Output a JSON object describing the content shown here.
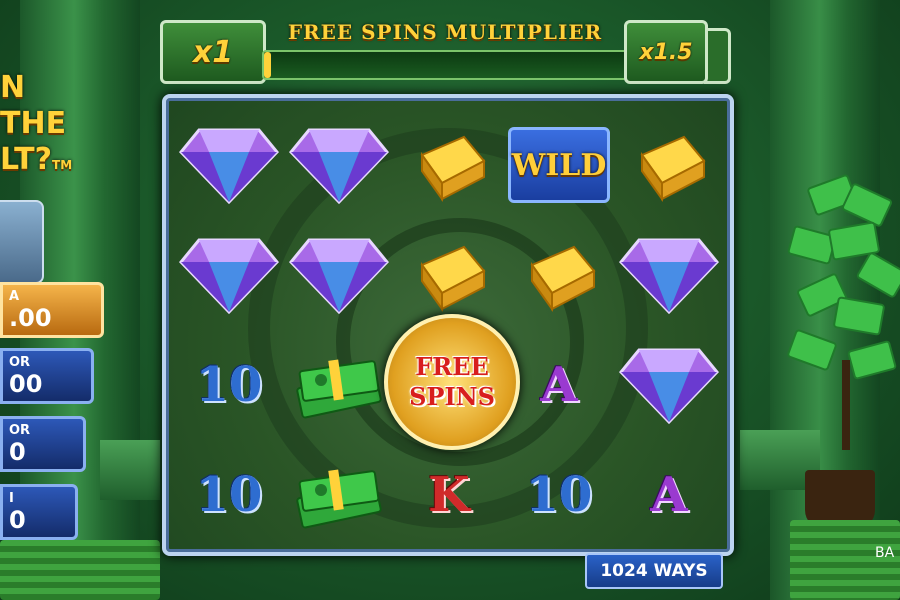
{
  "top_bar": {
    "title": "FREE SPINS MULTIPLIER",
    "multiplier_current": "x1",
    "multiplier_next": "x1.5",
    "progress": 0.02
  },
  "side_panel": {
    "title_line1": "N THE",
    "title_line2": "LT?",
    "trademark": "TM",
    "jackpots": [
      {
        "name": "A",
        "value": ".00",
        "icon": "question-icon"
      },
      {
        "name": "OR",
        "value": "00",
        "icon": "question-icon"
      },
      {
        "name": "OR",
        "value": "0",
        "icon": "question-icon"
      },
      {
        "name": "I",
        "value": "0",
        "icon": "question-icon"
      }
    ]
  },
  "reels": {
    "rows": [
      [
        "diamond",
        "diamond",
        "gold-bar",
        "wild",
        "gold-bar"
      ],
      [
        "diamond",
        "diamond",
        "gold-bar",
        "gold-bar",
        "diamond"
      ],
      [
        "10",
        "cash",
        "",
        "A",
        "diamond"
      ],
      [
        "10",
        "cash",
        "K",
        "10",
        "A"
      ]
    ],
    "wild_label": "WILD",
    "free_spins_line1": "FREE",
    "free_spins_line2": "SPINS"
  },
  "ways_label": "1024 WAYS",
  "balance_label": "BA",
  "colors": {
    "accent_gold": "#ffd23a",
    "frame": "#bcd4f0",
    "panel_blue": "#2d58b8"
  }
}
